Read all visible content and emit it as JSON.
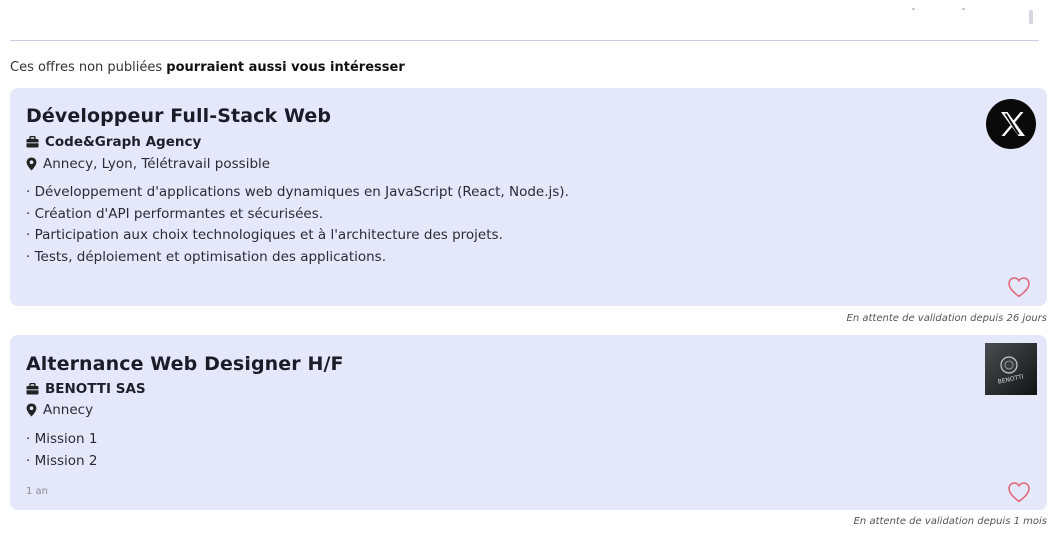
{
  "section": {
    "heading_prefix": "Ces offres non publiées ",
    "heading_bold": "pourraient aussi vous intéresser"
  },
  "offers": [
    {
      "title": "Développeur Full-Stack Web",
      "company": "Code&Graph Agency",
      "location": "Annecy, Lyon, Télétravail possible",
      "missions": [
        "· Développement d'applications web dynamiques en JavaScript (React, Node.js).",
        "· Création d'API performantes et sécurisées.",
        "· Participation aux choix technologiques et à l'architecture des projets.",
        "· Tests, déploiement et optimisation des applications."
      ],
      "logo_icon": "x-logo-icon",
      "status": "En attente de validation depuis 26 jours"
    },
    {
      "title": "Alternance Web Designer H/F",
      "company": "BENOTTI SAS",
      "location": "Annecy",
      "missions": [
        "· Mission 1",
        "· Mission 2"
      ],
      "age": "1 an",
      "logo_icon": "benotti-logo-icon",
      "logo_text": "BENOTTI",
      "status": "En attente de validation depuis 1 mois"
    }
  ],
  "colors": {
    "card_bg": "#e5e8fa",
    "heart": "#e0687a",
    "divider": "#cfcde6"
  }
}
